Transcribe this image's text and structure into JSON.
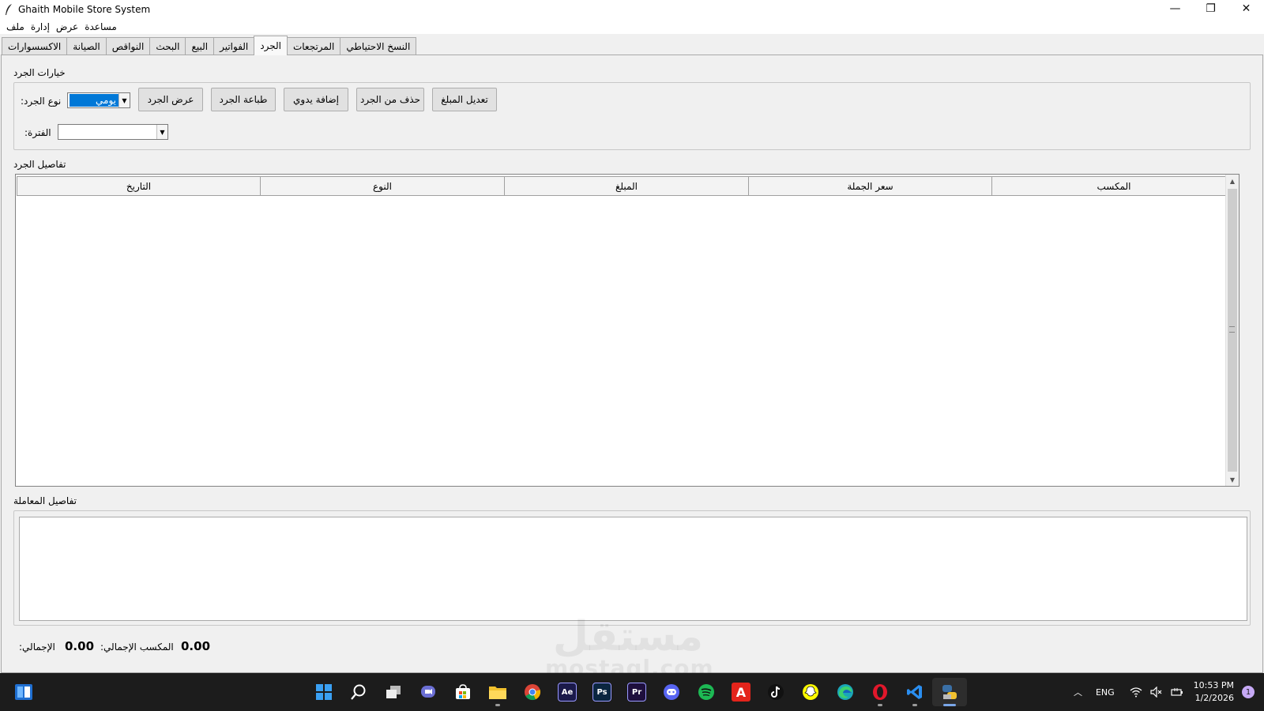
{
  "window": {
    "title": "Ghaith Mobile Store System",
    "minimize": "—",
    "restore": "❐",
    "close": "✕"
  },
  "menu": [
    "مساعدة",
    "عرض",
    "إدارة",
    "ملف"
  ],
  "tabs": [
    {
      "label": "النسخ الاحتياطي",
      "active": false
    },
    {
      "label": "المرتجعات",
      "active": false
    },
    {
      "label": "الجرد",
      "active": true
    },
    {
      "label": "الفواتير",
      "active": false
    },
    {
      "label": "البيع",
      "active": false
    },
    {
      "label": "البحث",
      "active": false
    },
    {
      "label": "النواقص",
      "active": false
    },
    {
      "label": "الصيانة",
      "active": false
    },
    {
      "label": "الاكسسوارات",
      "active": false
    }
  ],
  "inventory_options": {
    "frame_title": "خيارات الجرد",
    "type_label": ":نوع الجرد",
    "type_value": "يومي",
    "period_label": ":الفترة",
    "period_value": "",
    "buttons": {
      "show": "عرض الجرد",
      "print": "طباعة الجرد",
      "manual_add": "إضافة يدوي",
      "delete": "حذف من الجرد",
      "edit_amount": "تعديل المبلغ"
    }
  },
  "inventory_details": {
    "frame_title": "تفاصيل الجرد",
    "columns": [
      "التاريخ",
      "النوع",
      "المبلغ",
      "سعر الجملة",
      "المكسب"
    ]
  },
  "transaction_details": {
    "frame_title": "تفاصيل المعاملة"
  },
  "totals": {
    "total_label": ":الإجمالي",
    "total_value": "0.00",
    "profit_label": ":المكسب الإجمالي",
    "profit_value": "0.00"
  },
  "watermark": {
    "text": "مستقل",
    "sub": "mostaql.com"
  },
  "taskbar": {
    "icons": [
      {
        "name": "windows-start-icon",
        "color": "#3aa0f3"
      },
      {
        "name": "search-icon",
        "color": "#1c1c1c"
      },
      {
        "name": "task-view-icon",
        "color": "#1c1c1c"
      },
      {
        "name": "teams-chat-icon",
        "color": "#6b6fd4"
      },
      {
        "name": "microsoft-store-icon",
        "color": "#1c1c1c"
      },
      {
        "name": "file-explorer-icon",
        "color": "#f2c12e"
      },
      {
        "name": "chrome-icon",
        "color": "#1c1c1c"
      },
      {
        "name": "after-effects-icon",
        "color": "#1b1a4a",
        "text": "Ae"
      },
      {
        "name": "photoshop-icon",
        "color": "#0b2640",
        "text": "Ps"
      },
      {
        "name": "premiere-icon",
        "color": "#1e0f3d",
        "text": "Pr"
      },
      {
        "name": "discord-icon",
        "color": "#5865f2"
      },
      {
        "name": "spotify-icon",
        "color": "#1db954"
      },
      {
        "name": "acrobat-icon",
        "color": "#e3241b",
        "text": "A"
      },
      {
        "name": "tiktok-icon",
        "color": "#111111"
      },
      {
        "name": "snapchat-icon",
        "color": "#fffc00"
      },
      {
        "name": "edge-icon",
        "color": "#1aa7b8"
      },
      {
        "name": "opera-icon",
        "color": "#e2172b"
      },
      {
        "name": "vscode-icon",
        "color": "#1c1c1c"
      },
      {
        "name": "python-app-icon",
        "color": "#3a6fa5"
      }
    ],
    "lang": "ENG",
    "time": "10:53 PM",
    "date": "1/2/2026",
    "notifications": "1"
  }
}
